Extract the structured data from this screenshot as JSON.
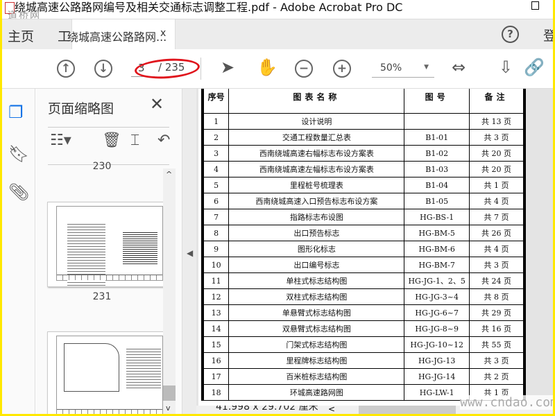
{
  "window": {
    "title": "绕城高速公路路网编号及相关交通标志调整工程.pdf - Adobe Acrobat Pro DC",
    "watermark_top": "道桥网",
    "watermark_bottom": "www.cndao.com"
  },
  "tabs": {
    "home": "主页",
    "tools": "工具",
    "document": "绕城高速公路路网...",
    "close": "x",
    "help": "?",
    "login": "登"
  },
  "toolbar": {
    "current_page": "3",
    "total_pages": "/ 235",
    "zoom": "50%"
  },
  "panel": {
    "title": "页面缩略图",
    "close": "✕",
    "pages": [
      {
        "label": "230"
      },
      {
        "label": "231"
      }
    ]
  },
  "status": {
    "dimensions": "41.998 x 29.702 厘米"
  },
  "table": {
    "headers": [
      "序号",
      "图表名称",
      "图号",
      "备注"
    ],
    "rows": [
      [
        "1",
        "设计说明",
        "",
        "共 13 页"
      ],
      [
        "2",
        "交通工程数量汇总表",
        "B1-01",
        "共 3 页"
      ],
      [
        "3",
        "西南绕城高速右幅标志布设方案表",
        "B1-02",
        "共 20 页"
      ],
      [
        "4",
        "西南绕城高速左幅标志布设方案表",
        "B1-03",
        "共 20 页"
      ],
      [
        "5",
        "里程桩号梳理表",
        "B1-04",
        "共 1 页"
      ],
      [
        "6",
        "西南绕城高速入口预告标志布设方案",
        "B1-05",
        "共 4 页"
      ],
      [
        "7",
        "指路标志布设图",
        "HG-BS-1",
        "共 7 页"
      ],
      [
        "8",
        "出口预告标志",
        "HG-BM-5",
        "共 26 页"
      ],
      [
        "9",
        "图形化标志",
        "HG-BM-6",
        "共 4 页"
      ],
      [
        "10",
        "出口编号标志",
        "HG-BM-7",
        "共 3 页"
      ],
      [
        "11",
        "单柱式标志结构图",
        "HG-JG-1、2、5",
        "共 24 页"
      ],
      [
        "12",
        "双柱式标志结构图",
        "HG-JG-3~4",
        "共 8 页"
      ],
      [
        "13",
        "单悬臂式标志结构图",
        "HG-JG-6~7",
        "共 29 页"
      ],
      [
        "14",
        "双悬臂式标志结构图",
        "HG-JG-8~9",
        "共 16 页"
      ],
      [
        "15",
        "门架式标志结构图",
        "HG-JG-10~12",
        "共 55 页"
      ],
      [
        "16",
        "里程牌标志结构图",
        "HG-JG-13",
        "共 3 页"
      ],
      [
        "17",
        "百米桩标志结构图",
        "HG-JG-14",
        "共 2 页"
      ],
      [
        "18",
        "环城高速路网图",
        "HG-LW-1",
        "共 1 页"
      ]
    ]
  },
  "colors": {
    "accent": "#1473e6",
    "annotation": "#e0141c",
    "frame": "#ffe800"
  }
}
